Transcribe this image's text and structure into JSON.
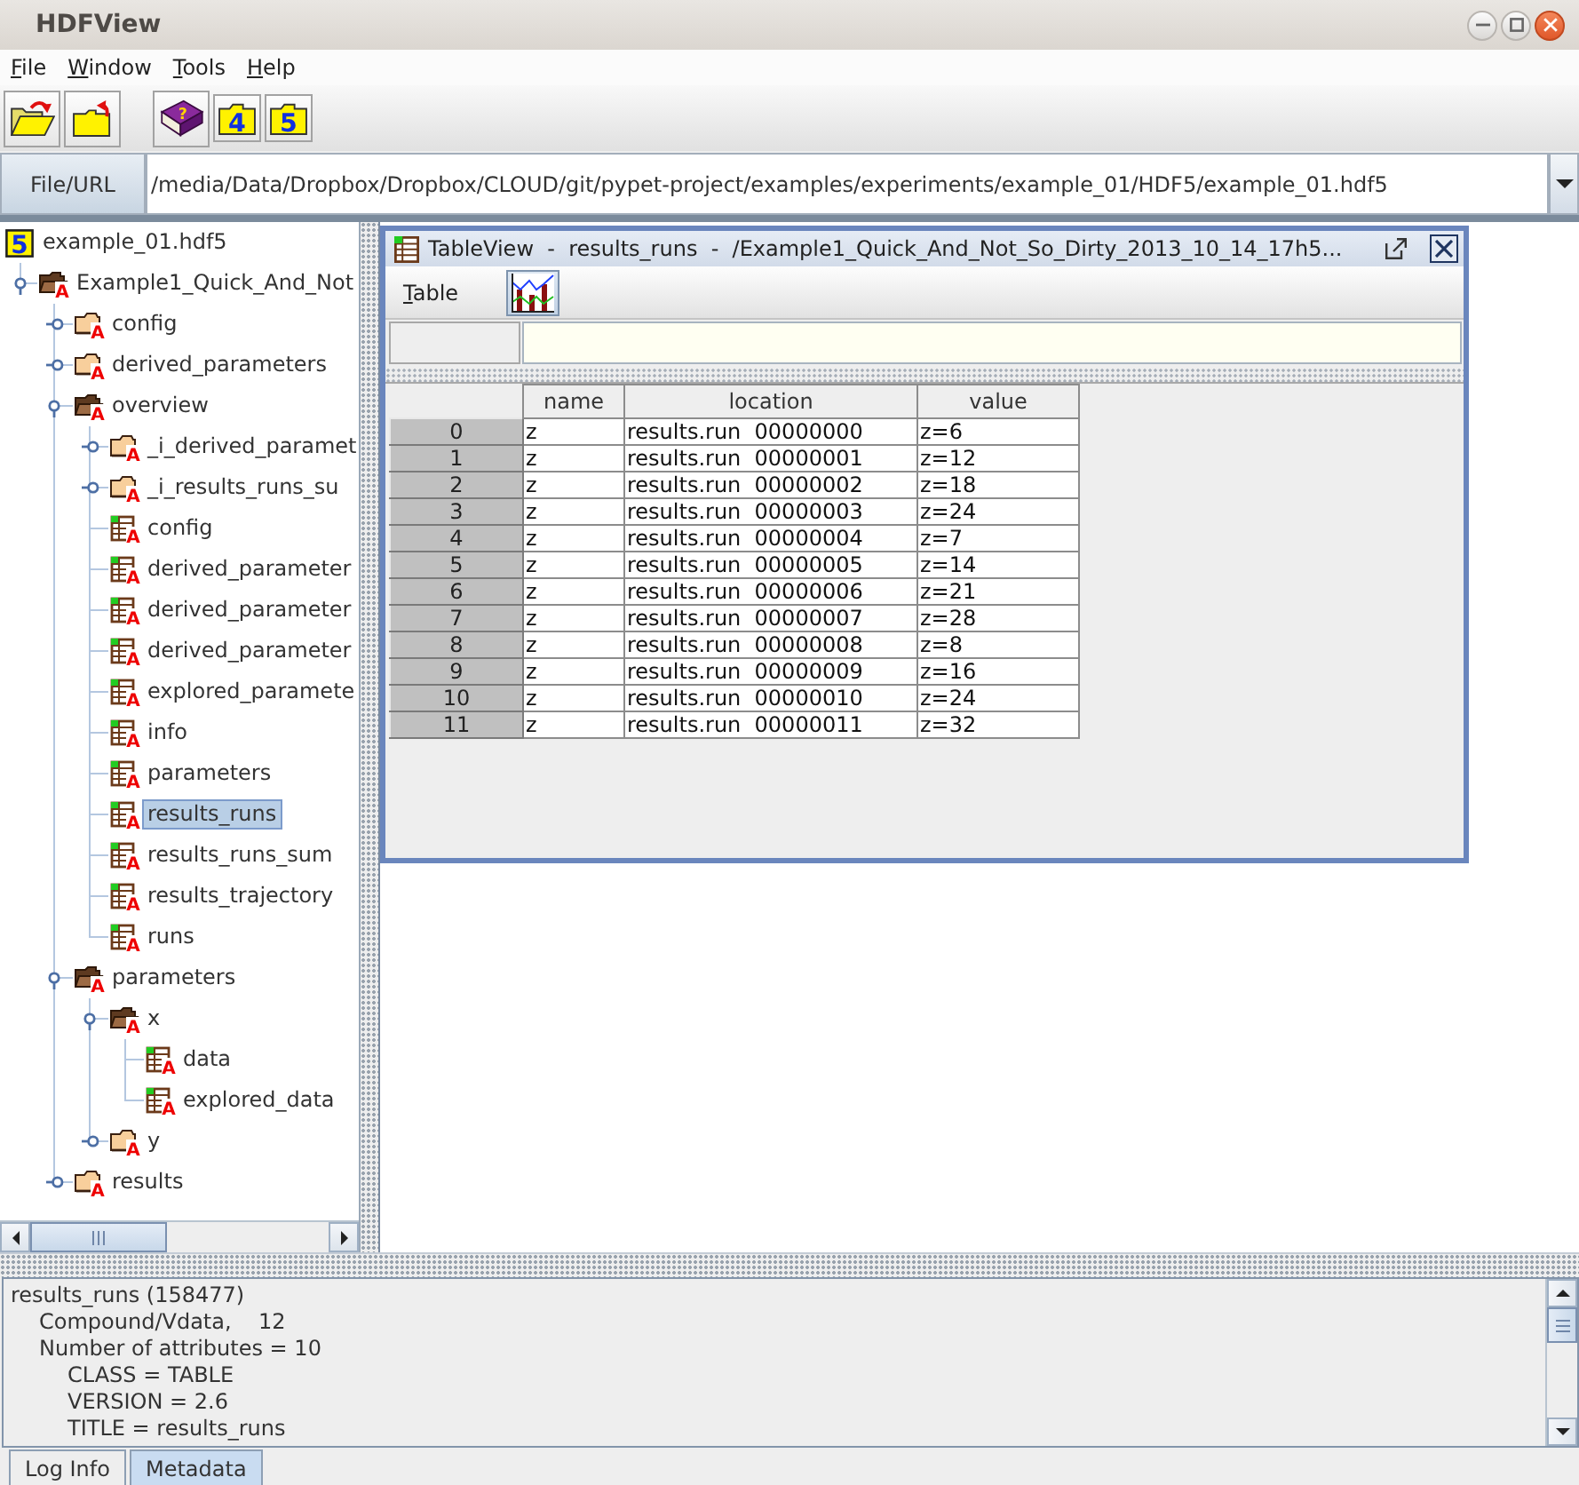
{
  "window": {
    "title": "HDFView"
  },
  "menu_bar": [
    "File",
    "Window",
    "Tools",
    "Help"
  ],
  "toolbar": {
    "groups": [
      {
        "buttons": [
          {
            "kind": "openfolder"
          },
          {
            "kind": "arrowfolder"
          }
        ]
      },
      {
        "buttons": [
          {
            "kind": "book",
            "glyph": "?"
          },
          {
            "kind": "digitfolder",
            "glyph": "4"
          },
          {
            "kind": "digitfolder",
            "glyph": "5"
          }
        ]
      }
    ]
  },
  "url_bar": {
    "button": "File/URL",
    "value": "/media/Data/Dropbox/Dropbox/CLOUD/git/pypet-project/examples/experiments/example_01/HDF5/example_01.hdf5"
  },
  "tree": {
    "root": {
      "label": "example_01.hdf5",
      "kind": "file",
      "badge": "5",
      "selected": false,
      "children": [
        {
          "label": "Example1_Quick_And_Not",
          "kind": "group",
          "badge": "A",
          "expanded": true,
          "selected": false,
          "children": [
            {
              "label": "config",
              "kind": "group",
              "badge": "A",
              "expanded": false,
              "selected": false
            },
            {
              "label": "derived_parameters",
              "kind": "group",
              "badge": "A",
              "expanded": false,
              "selected": false
            },
            {
              "label": "overview",
              "kind": "group",
              "badge": "A",
              "expanded": true,
              "selected": false,
              "children": [
                {
                  "label": "_i_derived_paramet",
                  "kind": "group",
                  "badge": "A",
                  "expanded": false,
                  "selected": false
                },
                {
                  "label": "_i_results_runs_su",
                  "kind": "group",
                  "badge": "A",
                  "expanded": false,
                  "selected": false
                },
                {
                  "label": "config",
                  "kind": "dataset",
                  "badge": "A",
                  "selected": false
                },
                {
                  "label": "derived_parameter",
                  "kind": "dataset",
                  "badge": "A",
                  "selected": false
                },
                {
                  "label": "derived_parameter",
                  "kind": "dataset",
                  "badge": "A",
                  "selected": false
                },
                {
                  "label": "derived_parameter",
                  "kind": "dataset",
                  "badge": "A",
                  "selected": false
                },
                {
                  "label": "explored_paramete",
                  "kind": "dataset",
                  "badge": "A",
                  "selected": false
                },
                {
                  "label": "info",
                  "kind": "dataset",
                  "badge": "A",
                  "selected": false
                },
                {
                  "label": "parameters",
                  "kind": "dataset",
                  "badge": "A",
                  "selected": false
                },
                {
                  "label": "results_runs",
                  "kind": "dataset",
                  "badge": "A",
                  "selected": true
                },
                {
                  "label": "results_runs_sum",
                  "kind": "dataset",
                  "badge": "A",
                  "selected": false
                },
                {
                  "label": "results_trajectory",
                  "kind": "dataset",
                  "badge": "A",
                  "selected": false
                },
                {
                  "label": "runs",
                  "kind": "dataset",
                  "badge": "A",
                  "selected": false
                }
              ]
            },
            {
              "label": "parameters",
              "kind": "group",
              "badge": "A",
              "expanded": true,
              "selected": false,
              "children": [
                {
                  "label": "x",
                  "kind": "group",
                  "badge": "A",
                  "expanded": true,
                  "selected": false,
                  "children": [
                    {
                      "label": "data",
                      "kind": "dataset",
                      "badge": "A",
                      "selected": false
                    },
                    {
                      "label": "explored_data",
                      "kind": "dataset",
                      "badge": "A",
                      "selected": false
                    }
                  ]
                },
                {
                  "label": "y",
                  "kind": "group",
                  "badge": "A",
                  "expanded": false,
                  "selected": false
                }
              ]
            },
            {
              "label": "results",
              "kind": "group",
              "badge": "A",
              "expanded": false,
              "selected": false
            }
          ]
        }
      ]
    }
  },
  "table_view": {
    "title": "TableView  -  results_runs  -  /Example1_Quick_And_Not_So_Dirty_2013_10_14_17h5...",
    "menu": "Table",
    "columns": [
      "name",
      "location",
      "value"
    ],
    "rows": [
      {
        "index": "0",
        "cells": [
          "z",
          "results.run  00000000",
          "z=6"
        ]
      },
      {
        "index": "1",
        "cells": [
          "z",
          "results.run  00000001",
          "z=12"
        ]
      },
      {
        "index": "2",
        "cells": [
          "z",
          "results.run  00000002",
          "z=18"
        ]
      },
      {
        "index": "3",
        "cells": [
          "z",
          "results.run  00000003",
          "z=24"
        ]
      },
      {
        "index": "4",
        "cells": [
          "z",
          "results.run  00000004",
          "z=7"
        ]
      },
      {
        "index": "5",
        "cells": [
          "z",
          "results.run  00000005",
          "z=14"
        ]
      },
      {
        "index": "6",
        "cells": [
          "z",
          "results.run  00000006",
          "z=21"
        ]
      },
      {
        "index": "7",
        "cells": [
          "z",
          "results.run  00000007",
          "z=28"
        ]
      },
      {
        "index": "8",
        "cells": [
          "z",
          "results.run  00000008",
          "z=8"
        ]
      },
      {
        "index": "9",
        "cells": [
          "z",
          "results.run  00000009",
          "z=16"
        ]
      },
      {
        "index": "10",
        "cells": [
          "z",
          "results.run  00000010",
          "z=24"
        ]
      },
      {
        "index": "11",
        "cells": [
          "z",
          "results.run  00000011",
          "z=32"
        ]
      }
    ]
  },
  "log": {
    "lines": [
      {
        "text": "results_runs (158477)",
        "children": [
          {
            "text": "Compound/Vdata,    12"
          },
          {
            "text": "Number of attributes = 10",
            "children": [
              {
                "text": "CLASS = TABLE"
              },
              {
                "text": "VERSION = 2.6"
              },
              {
                "text": "TITLE = results_runs"
              }
            ]
          }
        ]
      }
    ]
  },
  "tabs": [
    {
      "label": "Log Info",
      "selected": false
    },
    {
      "label": "Metadata",
      "selected": true
    }
  ]
}
